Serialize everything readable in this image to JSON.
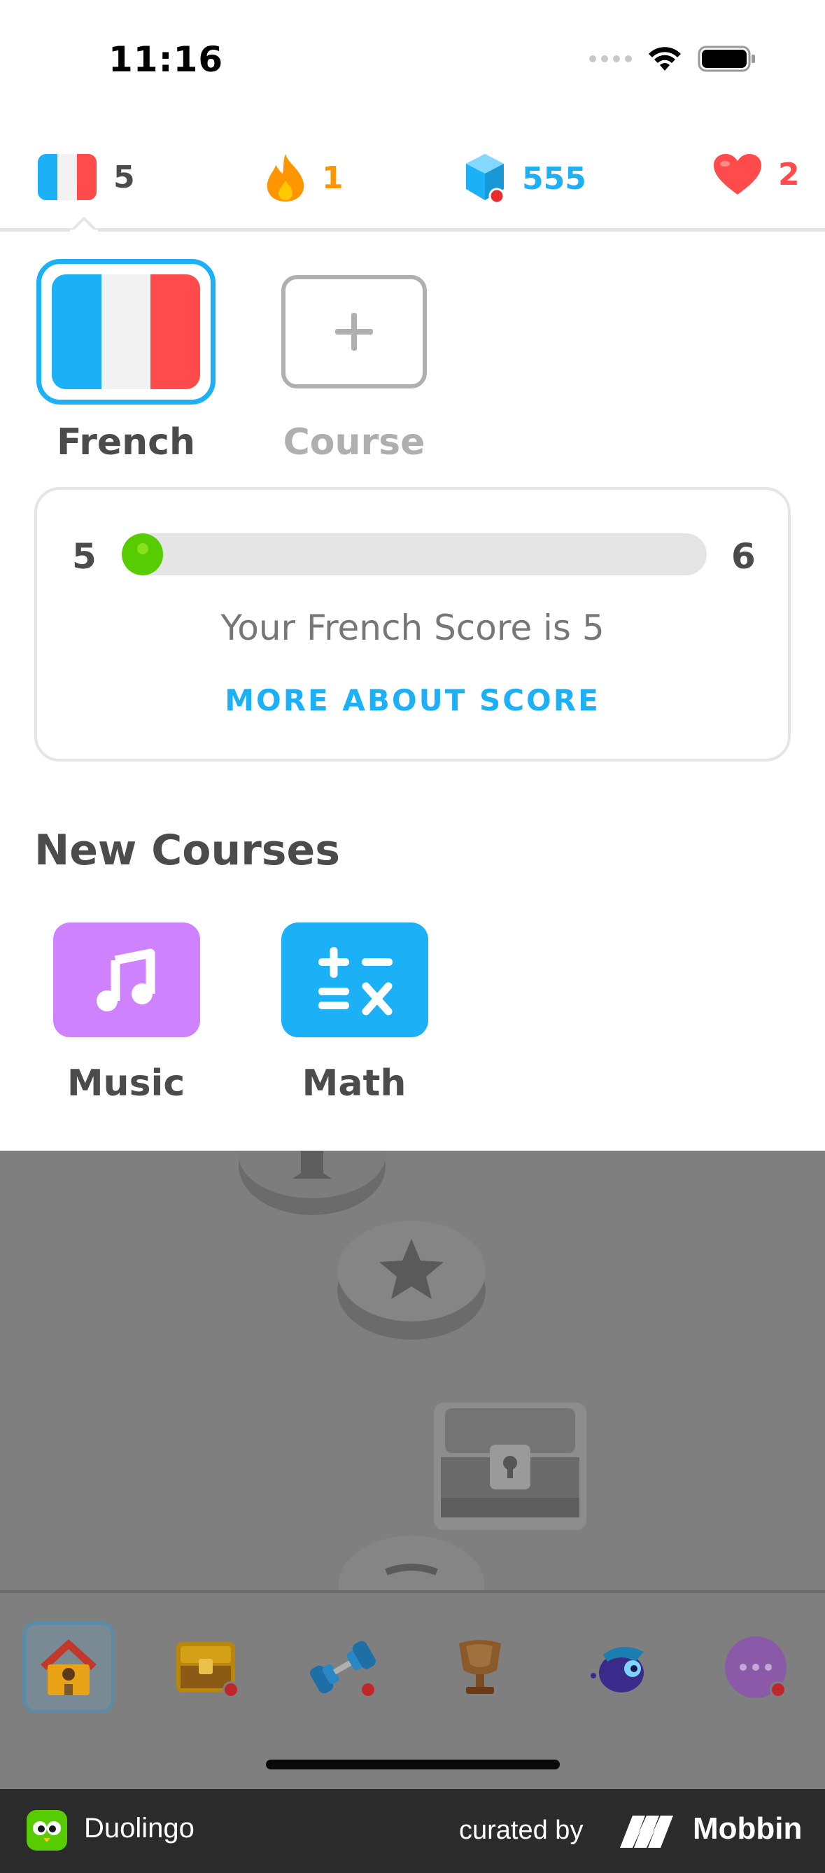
{
  "status_bar": {
    "time": "11:16"
  },
  "stats": {
    "course_level": "5",
    "streak": "1",
    "gems": "555",
    "hearts": "2",
    "colors": {
      "streak": "#ff9600",
      "gems": "#1cb0f6",
      "hearts": "#ff4b4b"
    }
  },
  "courses": {
    "current": {
      "label": "French",
      "flag_colors": [
        "#1cb0f6",
        "#f2f2f2",
        "#ff4b4b"
      ]
    },
    "add": {
      "label": "Course"
    }
  },
  "score": {
    "current": "5",
    "next": "6",
    "progress": 0.07,
    "text": "Your French Score is 5",
    "link": "MORE ABOUT SCORE"
  },
  "new_courses": {
    "title": "New Courses",
    "items": [
      {
        "label": "Music",
        "icon": "music-note-icon",
        "color": "#ce82ff"
      },
      {
        "label": "Math",
        "icon": "math-operators-icon",
        "color": "#1cb0f6"
      }
    ]
  },
  "tab_bar": {
    "items": [
      {
        "icon": "home-icon",
        "active": true
      },
      {
        "icon": "chest-icon",
        "badge": true
      },
      {
        "icon": "dumbbell-icon",
        "badge": true
      },
      {
        "icon": "trophy-icon"
      },
      {
        "icon": "character-icon"
      },
      {
        "icon": "more-icon",
        "badge": true
      }
    ]
  },
  "footer": {
    "app_name": "Duolingo",
    "curated_by": "curated by",
    "brand": "Mobbin"
  }
}
